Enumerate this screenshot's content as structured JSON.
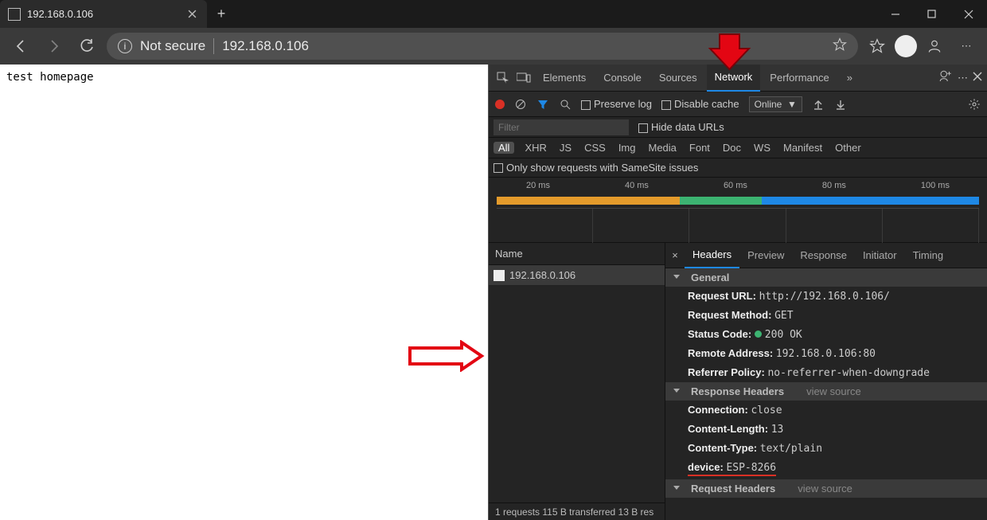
{
  "browser": {
    "tab_title": "192.168.0.106",
    "not_secure_label": "Not secure",
    "url": "192.168.0.106",
    "page_body": "test homepage"
  },
  "devtools": {
    "tabs": [
      "Elements",
      "Console",
      "Sources",
      "Network",
      "Performance"
    ],
    "active_tab": "Network",
    "preserve_log": "Preserve log",
    "disable_cache": "Disable cache",
    "throttle_selected": "Online",
    "filter_placeholder": "Filter",
    "hide_data_urls": "Hide data URLs",
    "type_filters": [
      "All",
      "XHR",
      "JS",
      "CSS",
      "Img",
      "Media",
      "Font",
      "Doc",
      "WS",
      "Manifest",
      "Other"
    ],
    "active_type_filter": "All",
    "only_samesite": "Only show requests with SameSite issues",
    "timeline_ticks": [
      "20 ms",
      "40 ms",
      "60 ms",
      "80 ms",
      "100 ms"
    ],
    "request_list_header": "Name",
    "requests": [
      {
        "name": "192.168.0.106"
      }
    ],
    "detail_tabs": [
      "Headers",
      "Preview",
      "Response",
      "Initiator",
      "Timing"
    ],
    "active_detail_tab": "Headers",
    "sections": {
      "general_title": "General",
      "general": [
        {
          "k": "Request URL:",
          "v": "http://192.168.0.106/"
        },
        {
          "k": "Request Method:",
          "v": "GET"
        },
        {
          "k": "Status Code:",
          "v": "200 OK",
          "status": true
        },
        {
          "k": "Remote Address:",
          "v": "192.168.0.106:80"
        },
        {
          "k": "Referrer Policy:",
          "v": "no-referrer-when-downgrade"
        }
      ],
      "response_headers_title": "Response Headers",
      "view_source": "view source",
      "response_headers": [
        {
          "k": "Connection:",
          "v": "close"
        },
        {
          "k": "Content-Length:",
          "v": "13"
        },
        {
          "k": "Content-Type:",
          "v": "text/plain"
        },
        {
          "k": "device:",
          "v": "ESP-8266",
          "highlight": true
        }
      ],
      "request_headers_title": "Request Headers"
    },
    "status_bar": "1 requests   115 B transferred   13 B res"
  }
}
